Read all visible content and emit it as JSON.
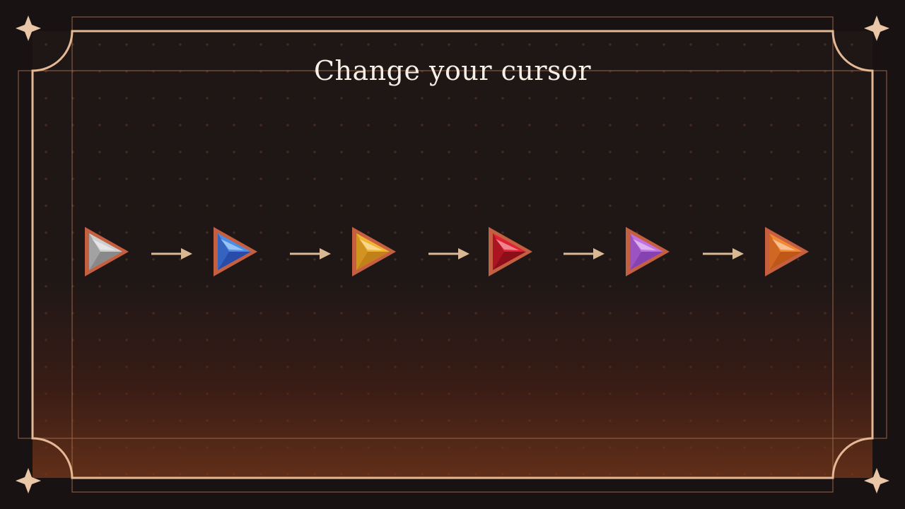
{
  "screen": {
    "title": "Change your cursor"
  },
  "cursor_sequence": [
    {
      "gem": "white",
      "color": "#cfcfcf",
      "dark": "#7d7d7d"
    },
    {
      "gem": "blue",
      "color": "#4a8ee8",
      "dark": "#233f9e"
    },
    {
      "gem": "gold",
      "color": "#f1b531",
      "dark": "#b87814"
    },
    {
      "gem": "red",
      "color": "#e02234",
      "dark": "#7d0a15"
    },
    {
      "gem": "purple",
      "color": "#c172de",
      "dark": "#7a3aa8"
    },
    {
      "gem": "orange",
      "color": "#f08a35",
      "dark": "#b64d14"
    }
  ],
  "colors": {
    "frame": "#e4b894",
    "arrow": "#d9b894",
    "gem_border": "#c55f42"
  }
}
